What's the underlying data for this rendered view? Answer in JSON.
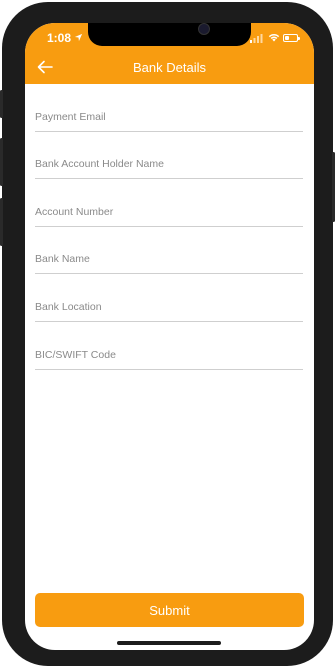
{
  "status_bar": {
    "time": "1:08"
  },
  "header": {
    "title": "Bank Details",
    "background": "#f89c10",
    "back_icon": "arrow-left-icon"
  },
  "form": {
    "fields": [
      {
        "placeholder": "Payment Email",
        "value": ""
      },
      {
        "placeholder": "Bank Account Holder Name",
        "value": ""
      },
      {
        "placeholder": "Account Number",
        "value": ""
      },
      {
        "placeholder": "Bank Name",
        "value": ""
      },
      {
        "placeholder": "Bank Location",
        "value": ""
      },
      {
        "placeholder": "BIC/SWIFT Code",
        "value": ""
      }
    ]
  },
  "submit": {
    "label": "Submit",
    "color": "#f89c10"
  }
}
